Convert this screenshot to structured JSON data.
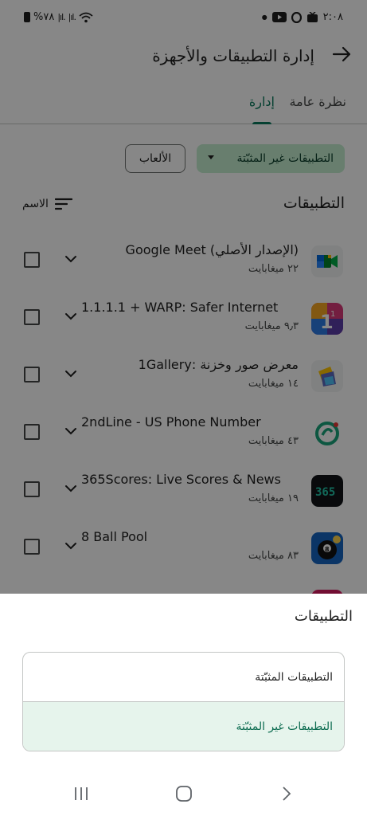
{
  "status_bar": {
    "time": "٢:٠٨",
    "battery": "%٧٨",
    "signal_1": "|ıl.",
    "signal_2": "|ıl."
  },
  "header": {
    "title": "إدارة التطبيقات والأجهزة"
  },
  "tabs": [
    {
      "label": "نظرة عامة",
      "selected": false
    },
    {
      "label": "إدارة",
      "selected": true
    }
  ],
  "filters": {
    "uninstalled_label": "التطبيقات غير المثبّتة",
    "games_label": "الألعاب"
  },
  "apps_section": {
    "title": "التطبيقات",
    "sort_label": "الاسم"
  },
  "apps": [
    {
      "name": "(الإصدار الأصلي) Google Meet",
      "size": "٢٢ ميغابايت",
      "icon": "google-meet-icon",
      "rtl": true
    },
    {
      "name": "1.1.1.1 + WARP: Safer Internet",
      "size": "٩٫٣ ميغابايت",
      "icon": "warp-icon",
      "rtl": false
    },
    {
      "name": "معرض صور وخزنة :1Gallery",
      "size": "١٤ ميغابايت",
      "icon": "gallery-icon",
      "rtl": true
    },
    {
      "name": "2ndLine - US Phone Number",
      "size": "٤٣ ميغابايت",
      "icon": "2ndline-icon",
      "rtl": false
    },
    {
      "name": "365Scores: Live Scores & News",
      "size": "١٩ ميغابايت",
      "icon": "365scores-icon",
      "rtl": false
    },
    {
      "name": "8 Ball Pool",
      "size": "٨٣ ميغابايت",
      "icon": "8-ball-pool-icon",
      "rtl": false
    }
  ],
  "sheet": {
    "title": "التطبيقات",
    "options": [
      {
        "label": "التطبيقات المثبّتة",
        "selected": false
      },
      {
        "label": "التطبيقات غير المثبّتة",
        "selected": true
      }
    ]
  },
  "colors": {
    "accent": "#0b7a5e",
    "chip_bg": "#c4eed0",
    "selected_option_bg": "#e6f4ec"
  }
}
